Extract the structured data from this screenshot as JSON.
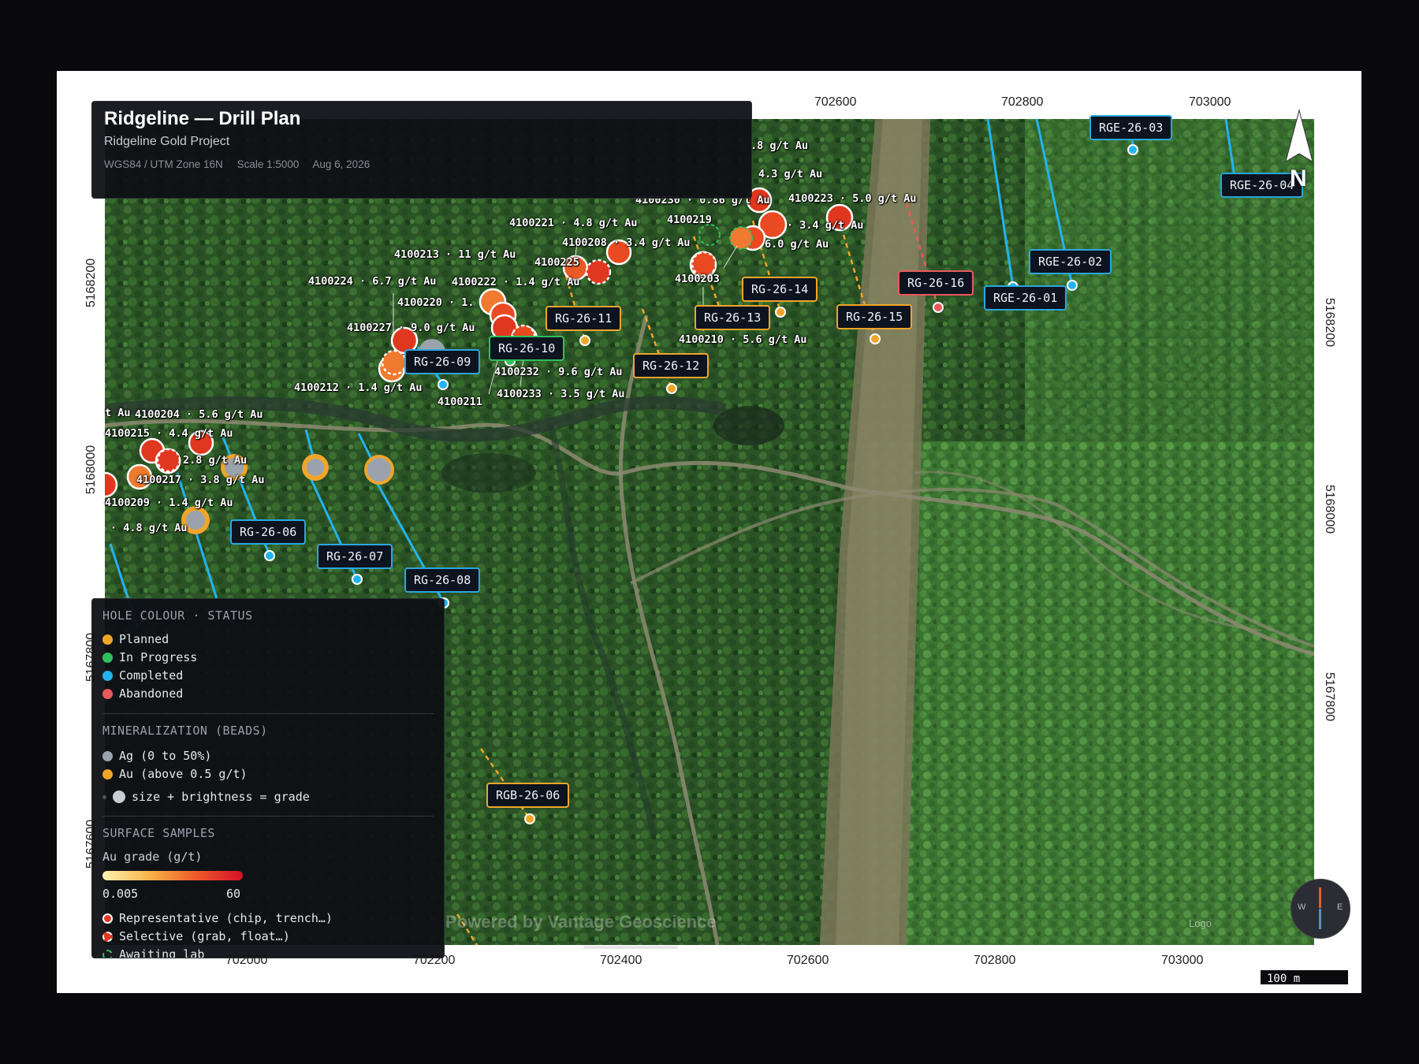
{
  "title": "Ridgeline — Drill Plan",
  "subtitle": "Ridgeline Gold Project",
  "meta": {
    "crs": "WGS84 / UTM Zone 16N",
    "scale": "Scale 1:5000",
    "date": "Aug 6, 2026"
  },
  "axes": {
    "top_x": [
      "702600",
      "702800",
      "703000"
    ],
    "bottom_x": [
      "702000",
      "702200",
      "702400",
      "702600",
      "702800",
      "703000"
    ],
    "left_y": [
      "5168200",
      "5168000",
      "5167800",
      "5167600"
    ],
    "right_y": [
      "5168200",
      "5168000",
      "5167800"
    ]
  },
  "north_label": "N",
  "scale_bar": "100 m",
  "watermark": "Powered by Vantage Geoscience",
  "logo_text": "Logo",
  "compass": {
    "w": "W",
    "e": "E"
  },
  "colors": {
    "planned": "#f0a52a",
    "in_progress": "#2fbf5c",
    "completed": "#2aa7e0",
    "abandoned": "#e85a5a",
    "ag": "#9aa3ad",
    "au": "#f0a52a"
  },
  "holes": [
    {
      "id": "RGE-26-03",
      "status": "completed"
    },
    {
      "id": "RGE-26-04",
      "status": "completed"
    },
    {
      "id": "RGE-26-02",
      "status": "completed"
    },
    {
      "id": "RGE-26-01",
      "status": "completed"
    },
    {
      "id": "RG-26-16",
      "status": "abandoned"
    },
    {
      "id": "RG-26-15",
      "status": "planned"
    },
    {
      "id": "RG-26-14",
      "status": "planned"
    },
    {
      "id": "RG-26-13",
      "status": "planned"
    },
    {
      "id": "RG-26-12",
      "status": "planned"
    },
    {
      "id": "RG-26-11",
      "status": "planned"
    },
    {
      "id": "RG-26-10",
      "status": "in_progress"
    },
    {
      "id": "RG-26-09",
      "status": "completed"
    },
    {
      "id": "RG-26-06",
      "status": "completed"
    },
    {
      "id": "RG-26-07",
      "status": "completed"
    },
    {
      "id": "RG-26-08",
      "status": "completed"
    },
    {
      "id": "RGB-26-06",
      "status": "planned"
    }
  ],
  "samples": [
    {
      "id": "4100230",
      "grade": "0.86 g/t Au",
      "text": "4100230 · 0.86 g/t Au"
    },
    {
      "id": "4100223",
      "grade": "5.0 g/t Au",
      "text": "4100223 · 5.0 g/t Au"
    },
    {
      "id": "4100221",
      "grade": "4.8 g/t Au",
      "text": "4100221 · 4.8 g/t Au"
    },
    {
      "id": "4100219",
      "text": "4100219"
    },
    {
      "id": "4100208",
      "grade": "3.4 g/t Au",
      "text": "4100208 · 3.4 g/t Au"
    },
    {
      "id": "4100213",
      "grade": "11 g/t Au",
      "text": "4100213 · 11 g/t Au"
    },
    {
      "id": "4100225",
      "text": "4100225"
    },
    {
      "id": "4100224",
      "grade": "6.7 g/t Au",
      "text": "4100224 · 6.7 g/t Au"
    },
    {
      "id": "4100222",
      "grade": "1.4 g/t Au",
      "text": "4100222 · 1.4 g/t Au"
    },
    {
      "id": "4100220",
      "text": "4100220 · 1."
    },
    {
      "id": "4100227",
      "text": "4100227 · 9.0 g/t Au"
    },
    {
      "id": "4100203",
      "text": "4100203"
    },
    {
      "id": "4100210",
      "grade": "5.6 g/t Au",
      "text": "4100210 · 5.6 g/t Au"
    },
    {
      "id": "4100232",
      "grade": "9.6 g/t Au",
      "text": "4100232 · 9.6 g/t Au"
    },
    {
      "id": "4100212",
      "grade": "1.4 g/t Au",
      "text": "4100212 · 1.4 g/t Au"
    },
    {
      "id": "4100233",
      "grade": "3.5 g/t Au",
      "text": "4100233 · 3.5 g/t Au"
    },
    {
      "id": "4100211",
      "text": "4100211"
    },
    {
      "id": "4100204",
      "grade": "5.6 g/t Au",
      "text": "4100204 · 5.6 g/t Au"
    },
    {
      "id": "4100215",
      "grade": "4.4 g/t Au",
      "text": "4100215 · 4.4 g/t Au"
    },
    {
      "id": "4100217",
      "grade": "3.8 g/t Au",
      "text": "4100217 · 3.8 g/t Au"
    },
    {
      "id": "4100209",
      "grade": "1.4 g/t Au",
      "text": "4100209 · 1.4 g/t Au"
    },
    {
      "text": "· 4.8 g/t Au"
    },
    {
      "text": "2.8 g/t Au"
    },
    {
      "text": "· 3.4 g/t Au"
    },
    {
      "text": "6.0 g/t Au"
    },
    {
      "text": "4.3 g/t Au"
    },
    {
      "text": ".8 g/t Au"
    },
    {
      "text": "t Au"
    }
  ],
  "legend": {
    "status_header": "HOLE COLOUR · STATUS",
    "status": [
      "Planned",
      "In Progress",
      "Completed",
      "Abandoned"
    ],
    "min_header": "MINERALIZATION (BEADS)",
    "min": [
      "Ag (0 to 50%)",
      "Au (above 0.5 g/t)"
    ],
    "size_note": "size + brightness = grade",
    "surface_header": "SURFACE SAMPLES",
    "grade_title": "Au grade (g/t)",
    "grade_min": "0.005",
    "grade_max": "60",
    "sample_types": [
      "Representative (chip, trench…)",
      "Selective (grab, float…)",
      "Awaiting lab"
    ]
  }
}
